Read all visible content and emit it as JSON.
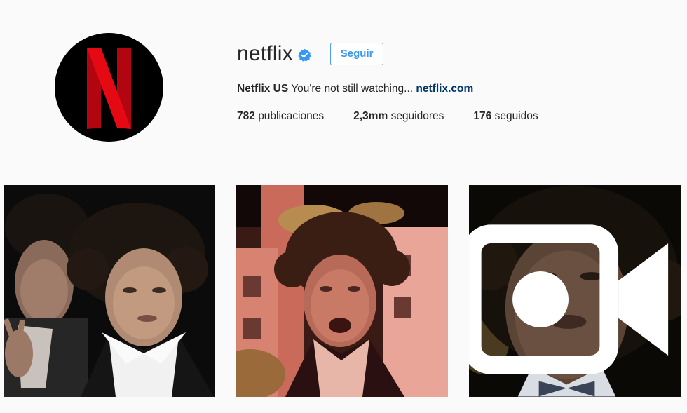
{
  "profile": {
    "username": "netflix",
    "verified": true,
    "follow_label": "Seguir",
    "avatar_icon": "netflix-logo-icon",
    "brand_color": "#e50914",
    "accent_color": "#3897f0",
    "bio": {
      "name": "Netflix US",
      "text": "You're not still watching...",
      "link": "netflix.com"
    },
    "stats": {
      "posts_count": "782",
      "posts_label": "publicaciones",
      "followers_count": "2,3mm",
      "followers_label": "seguidores",
      "following_count": "176",
      "following_label": "seguidos"
    }
  },
  "posts": [
    {
      "type": "photo"
    },
    {
      "type": "photo"
    },
    {
      "type": "video",
      "badge_icon": "video-camera-icon"
    }
  ]
}
